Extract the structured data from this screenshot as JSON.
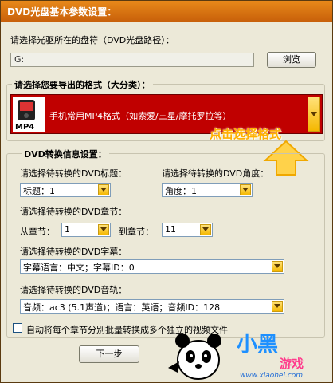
{
  "window": {
    "title": "DVD光盘基本参数设置："
  },
  "drive": {
    "label": "请选择光驱所在的盘符（DVD光盘路径）：",
    "value": "G:",
    "browse_label": "浏览"
  },
  "format": {
    "group_title": "请选择您要导出的格式（大分类）：",
    "selected": "手机常用MP4格式（如索爱/三星/摩托罗拉等）",
    "icon_label": "MP4",
    "hint": "点击选择格式"
  },
  "dvd_info": {
    "group_title": "DVD转换信息设置：",
    "title_label": "请选择待转换的DVD标题：",
    "title_value": "标题：1",
    "angle_label": "请选择待转换的DVD角度：",
    "angle_value": "角度：1",
    "chapter_label": "请选择待转换的DVD章节：",
    "from_label": "从章节：",
    "from_value": "1",
    "to_label": "到章节：",
    "to_value": "11",
    "subtitle_label": "请选择待转换的DVD字幕：",
    "subtitle_value": "字幕语言：中文；字幕ID：0",
    "audio_label": "请选择待转换的DVD音轨：",
    "audio_value": "音频：ac3 (5.1声道)；语言：英语；音频ID：128",
    "split_label": "自动将每个章节分别批量转换成多个独立的视频文件",
    "split_checked": false
  },
  "next_label": "下一步",
  "watermark": {
    "brand": "小黑",
    "brand2": "游戏",
    "url": "www.xiaohei.com"
  }
}
